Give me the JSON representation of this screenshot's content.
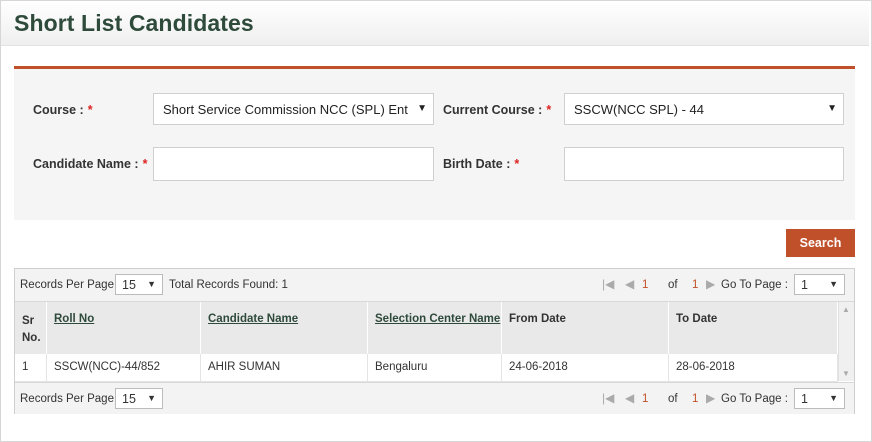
{
  "page": {
    "title": "Short List Candidates"
  },
  "form": {
    "course_label": "Course :",
    "course_value": "Short Service Commission NCC (SPL) Ent",
    "current_course_label": "Current Course :",
    "current_course_value": "SSCW(NCC SPL) - 44",
    "candidate_name_label": "Candidate Name :",
    "candidate_name_value": "",
    "birth_date_label": "Birth Date :",
    "birth_date_value": "",
    "required_mark": "*",
    "search_label": "Search"
  },
  "pager": {
    "records_per_page_label": "Records Per Page :",
    "records_per_page_value": "15",
    "total_records_text": "Total Records Found: 1",
    "current_page": "1",
    "of_label": "of",
    "total_pages": "1",
    "go_to_label": "Go To Page :",
    "go_to_value": "1"
  },
  "table": {
    "headers": [
      "Sr No.",
      "Roll No",
      "Candidate Name",
      "Selection Center Name",
      "From Date",
      "To Date"
    ],
    "rows": [
      [
        "1",
        "SSCW(NCC)-44/852",
        "AHIR SUMAN",
        "Bengaluru",
        "24-06-2018",
        "28-06-2018"
      ]
    ]
  },
  "colors": {
    "accent": "#c0502a",
    "title": "#2e4a3b",
    "link": "#2e4a3b",
    "required": "#dd2222"
  },
  "icons": [
    "dropdown-arrow-icon",
    "first-page-icon",
    "prev-page-icon",
    "next-page-icon",
    "scroll-up-icon",
    "scroll-down-icon"
  ]
}
